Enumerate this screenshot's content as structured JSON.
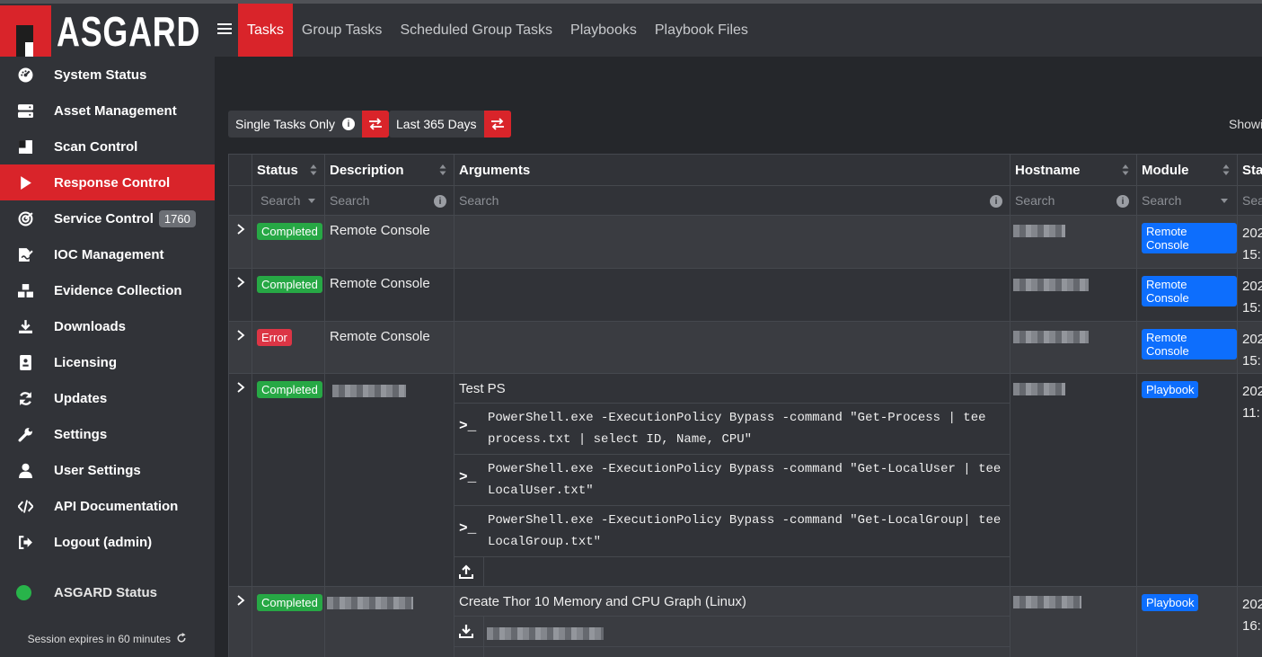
{
  "app": {
    "logo_text": "ASGARD"
  },
  "sidebar": {
    "items": [
      {
        "label": "System Status",
        "icon": "dashboard-icon"
      },
      {
        "label": "Asset Management",
        "icon": "server-icon"
      },
      {
        "label": "Scan Control",
        "icon": "scan-icon"
      },
      {
        "label": "Response Control",
        "icon": "play-icon",
        "active": true
      },
      {
        "label": "Service Control",
        "icon": "radar-icon",
        "badge": "1760"
      },
      {
        "label": "IOC Management",
        "icon": "file-signature-icon"
      },
      {
        "label": "Evidence Collection",
        "icon": "boxes-icon"
      },
      {
        "label": "Downloads",
        "icon": "download-icon"
      },
      {
        "label": "Licensing",
        "icon": "id-card-icon"
      },
      {
        "label": "Updates",
        "icon": "sync-icon"
      },
      {
        "label": "Settings",
        "icon": "wrench-icon"
      },
      {
        "label": "User Settings",
        "icon": "user-icon"
      },
      {
        "label": "API Documentation",
        "icon": "code-icon"
      },
      {
        "label": "Logout (admin)",
        "icon": "sign-out-icon"
      }
    ],
    "status_label": "ASGARD Status",
    "session": "Session expires in 60 minutes"
  },
  "topnav": {
    "tabs": [
      "Tasks",
      "Group Tasks",
      "Scheduled Group Tasks",
      "Playbooks",
      "Playbook Files"
    ],
    "active": "Tasks"
  },
  "filters": {
    "single": "Single Tasks Only",
    "range": "Last 365 Days",
    "showing": "Showin"
  },
  "table": {
    "headers": {
      "status": "Status",
      "description": "Description",
      "arguments": "Arguments",
      "hostname": "Hostname",
      "module": "Module",
      "start": "Sta"
    },
    "search": {
      "status": "Search",
      "description": "Search",
      "arguments": "Search",
      "hostname": "Search",
      "module": "Search",
      "start": "Sea"
    },
    "rows": [
      {
        "status": "Completed",
        "description": "Remote Console",
        "module": "Remote Console",
        "start1": "202",
        "start2": "15:"
      },
      {
        "status": "Completed",
        "description": "Remote Console",
        "module": "Remote Console",
        "start1": "202",
        "start2": "15:"
      },
      {
        "status": "Error",
        "description": "Remote Console",
        "module": "Remote Console",
        "start1": "202",
        "start2": "15:"
      },
      {
        "status": "Completed",
        "arg_title": "Test PS",
        "module": "Playbook",
        "start1": "202",
        "start2": "11:",
        "commands": [
          {
            "l1": "PowerShell.exe -ExecutionPolicy Bypass -command \"Get-Process | tee",
            "l2": "process.txt | select ID, Name, CPU\""
          },
          {
            "l1": "PowerShell.exe -ExecutionPolicy Bypass -command \"Get-LocalUser | tee",
            "l2": "LocalUser.txt\""
          },
          {
            "l1": "PowerShell.exe -ExecutionPolicy Bypass -command \"Get-LocalGroup| tee",
            "l2": "LocalGroup.txt\""
          }
        ]
      },
      {
        "status": "Completed",
        "arg_title": "Create Thor 10 Memory and CPU Graph (Linux)",
        "module": "Playbook",
        "start1": "202",
        "start2": "16:"
      }
    ]
  },
  "colors": {
    "accent": "#d9242a",
    "completed": "#27a845",
    "error": "#dc3545",
    "module": "#0d6efd"
  }
}
